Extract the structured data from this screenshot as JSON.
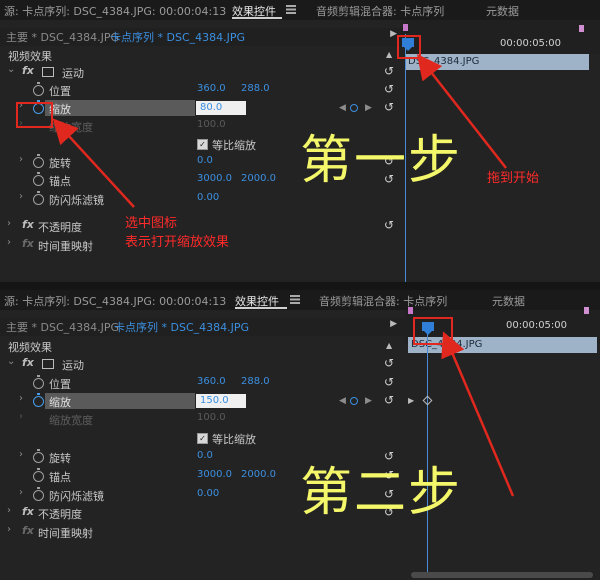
{
  "panel1": {
    "tabs": [
      "源: 卡点序列: DSC_4384.JPG: 00:00:04:13",
      "效果控件",
      "音频剪辑混合器: 卡点序列",
      "元数据"
    ],
    "source_main": "主要 * DSC_4384.JPG",
    "source_seq": "卡点序列 * DSC_4384.JPG",
    "video_effects": "视频效果",
    "motion": "运动",
    "position": {
      "label": "位置",
      "x": "360.0",
      "y": "288.0"
    },
    "scale": {
      "label": "缩放",
      "value": "80.0"
    },
    "scale_width": {
      "label": "缩放宽度",
      "value": "100.0"
    },
    "uniform_scale": "等比缩放",
    "rotation": {
      "label": "旋转",
      "value": "0.0"
    },
    "anchor": {
      "label": "锚点",
      "x": "3000.0",
      "y": "2000.0"
    },
    "anti_flicker": {
      "label": "防闪烁滤镜",
      "value": "0.00"
    },
    "opacity": "不透明度",
    "time_remap": "时间重映射",
    "timecode": "00:00:05:00",
    "clip_name": "DSC_4384.JPG",
    "step_text": "第一步",
    "annotation_left_line1": "选中图标",
    "annotation_left_line2": "表示打开缩放效果",
    "annotation_right": "拖到开始"
  },
  "panel2": {
    "tabs": [
      "源: 卡点序列: DSC_4384.JPG: 00:00:04:13",
      "效果控件",
      "音频剪辑混合器: 卡点序列",
      "元数据"
    ],
    "source_main": "主要 * DSC_4384.JPG",
    "source_seq": "卡点序列 * DSC_4384.JPG",
    "video_effects": "视频效果",
    "motion": "运动",
    "position": {
      "label": "位置",
      "x": "360.0",
      "y": "288.0"
    },
    "scale": {
      "label": "缩放",
      "value": "150.0"
    },
    "scale_width": {
      "label": "缩放宽度",
      "value": "100.0"
    },
    "uniform_scale": "等比缩放",
    "rotation": {
      "label": "旋转",
      "value": "0.0"
    },
    "anchor": {
      "label": "锚点",
      "x": "3000.0",
      "y": "2000.0"
    },
    "anti_flicker": {
      "label": "防闪烁滤镜",
      "value": "0.00"
    },
    "opacity": "不透明度",
    "time_remap": "时间重映射",
    "timecode": "00:00:05:00",
    "clip_name": "DSC_4384.JPG",
    "step_text": "第二步"
  },
  "colors": {
    "accent_blue": "#3b8fe0",
    "annotation_red": "#e0281e",
    "step_yellow": "#f4f76a"
  },
  "icons": [
    "stopwatch-icon",
    "fx-icon",
    "reset-icon",
    "chevron-icon",
    "motion-icon",
    "playhead-icon",
    "keyframe-icon"
  ]
}
